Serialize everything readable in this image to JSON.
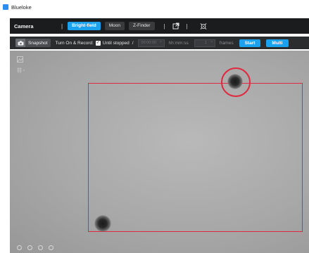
{
  "window": {
    "title": "Blueloke"
  },
  "header": {
    "title": "Camera",
    "separator": "|",
    "tabs": [
      {
        "label": "Bright-field",
        "active": true
      },
      {
        "label": "Moon",
        "active": false
      },
      {
        "label": "Z-Finder",
        "active": false
      }
    ],
    "icons": [
      "external-link-icon",
      "target-icon"
    ]
  },
  "controls": {
    "snapshot_label": "Snapshot",
    "turn_on_record_label": "Turn On & Record:",
    "until_stopped_checked": true,
    "until_stopped_label": "Until stopped",
    "slash": "/",
    "time_value": "00:00:00",
    "time_unit": "hh:mm:ss",
    "frames_value": "1",
    "frames_unit": "frames",
    "start_label": "Start",
    "multi_label": "Multi"
  },
  "viewer": {
    "pager_dot_count": 4
  },
  "colors": {
    "accent": "#1aa2ee",
    "roi": "#e0283e",
    "header_bg": "#1b1c1e",
    "controls_bg": "#2b2c2e"
  }
}
